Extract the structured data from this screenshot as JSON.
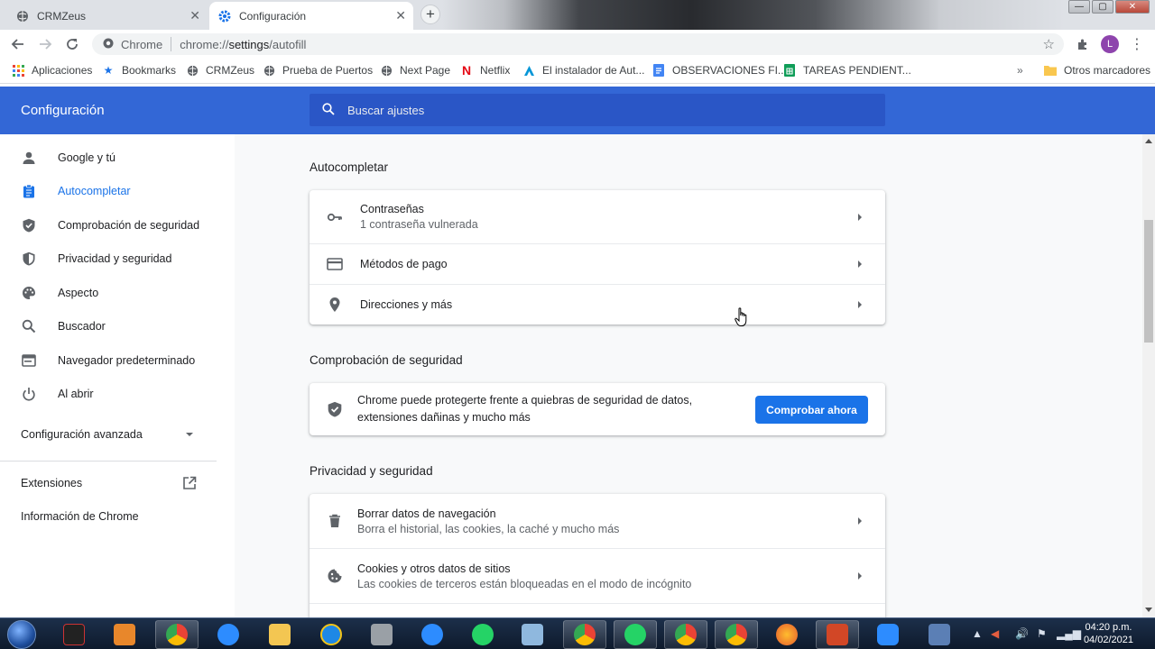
{
  "tabs": [
    {
      "title": "CRMZeus",
      "icon": "globe-icon",
      "active": false
    },
    {
      "title": "Configuración",
      "icon": "gear-icon",
      "active": true
    }
  ],
  "omnibox": {
    "site_label": "Chrome",
    "url_prefix": "chrome://",
    "url_path": "settings",
    "url_suffix": "/autofill"
  },
  "profile_initial": "L",
  "bookmarks": [
    {
      "label": "Aplicaciones",
      "icon": "apps-grid-icon"
    },
    {
      "label": "Bookmarks",
      "icon": "star-icon"
    },
    {
      "label": "CRMZeus",
      "icon": "globe-icon"
    },
    {
      "label": "Prueba de Puertos",
      "icon": "globe-icon"
    },
    {
      "label": "Next Page",
      "icon": "globe-icon"
    },
    {
      "label": "Netflix",
      "icon": "netflix-icon"
    },
    {
      "label": "El instalador de Aut...",
      "icon": "autodesk-icon"
    },
    {
      "label": "OBSERVACIONES FI...",
      "icon": "docs-icon"
    },
    {
      "label": "TAREAS PENDIENT...",
      "icon": "sheets-icon"
    }
  ],
  "other_bookmarks": "Otros marcadores",
  "settings": {
    "title": "Configuración",
    "search_placeholder": "Buscar ajustes"
  },
  "sidebar": {
    "items": [
      {
        "label": "Google y tú",
        "icon": "person-icon",
        "active": false
      },
      {
        "label": "Autocompletar",
        "icon": "clipboard-icon",
        "active": true
      },
      {
        "label": "Comprobación de seguridad",
        "icon": "shield-check-icon",
        "active": false
      },
      {
        "label": "Privacidad y seguridad",
        "icon": "shield-icon",
        "active": false
      },
      {
        "label": "Aspecto",
        "icon": "palette-icon",
        "active": false
      },
      {
        "label": "Buscador",
        "icon": "search-icon",
        "active": false
      },
      {
        "label": "Navegador predeterminado",
        "icon": "browser-icon",
        "active": false
      },
      {
        "label": "Al abrir",
        "icon": "power-icon",
        "active": false
      }
    ],
    "advanced": "Configuración avanzada",
    "extensions": "Extensiones",
    "about": "Información de Chrome"
  },
  "autofill": {
    "title": "Autocompletar",
    "rows": [
      {
        "primary": "Contraseñas",
        "secondary": "1 contraseña vulnerada",
        "icon": "key-icon"
      },
      {
        "primary": "Métodos de pago",
        "icon": "credit-card-icon"
      },
      {
        "primary": "Direcciones y más",
        "icon": "location-pin-icon"
      }
    ]
  },
  "safety": {
    "title": "Comprobación de seguridad",
    "text": "Chrome puede protegerte frente a quiebras de seguridad de datos, extensiones dañinas y mucho más",
    "button": "Comprobar ahora"
  },
  "privacy": {
    "title": "Privacidad y seguridad",
    "rows": [
      {
        "primary": "Borrar datos de navegación",
        "secondary": "Borra el historial, las cookies, la caché y mucho más",
        "icon": "trash-icon"
      },
      {
        "primary": "Cookies y otros datos de sitios",
        "secondary": "Las cookies de terceros están bloqueadas en el modo de incógnito",
        "icon": "cookie-icon"
      }
    ]
  },
  "taskbar": {
    "time": "04:20 p.m.",
    "date": "04/02/2021"
  },
  "colors": {
    "header": "#3367d6",
    "search_bg": "#2a56c6",
    "accent": "#1a73e8",
    "content_bg": "#f8f9fa"
  }
}
